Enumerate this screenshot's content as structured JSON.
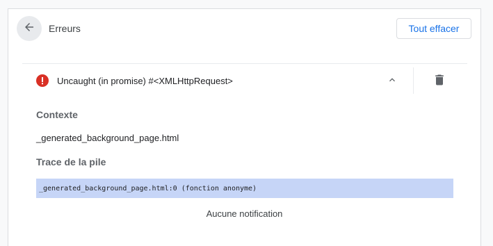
{
  "header": {
    "title": "Erreurs",
    "clear_all_label": "Tout effacer",
    "back_icon": "arrow-back-icon"
  },
  "error": {
    "title": "Uncaught (in promise) #<XMLHttpRequest>",
    "status_icon": "error-icon",
    "collapse_icon": "chevron-up-icon",
    "delete_icon": "trash-icon",
    "context_heading": "Contexte",
    "context_value": "_generated_background_page.html",
    "stack_heading": "Trace de la pile",
    "stack_frames": [
      "_generated_background_page.html:0 (fonction anonyme)"
    ],
    "notification_text": "Aucune notification"
  },
  "colors": {
    "accent": "#1a73e8",
    "error": "#d93025",
    "stack_highlight": "#c6d5f7"
  }
}
